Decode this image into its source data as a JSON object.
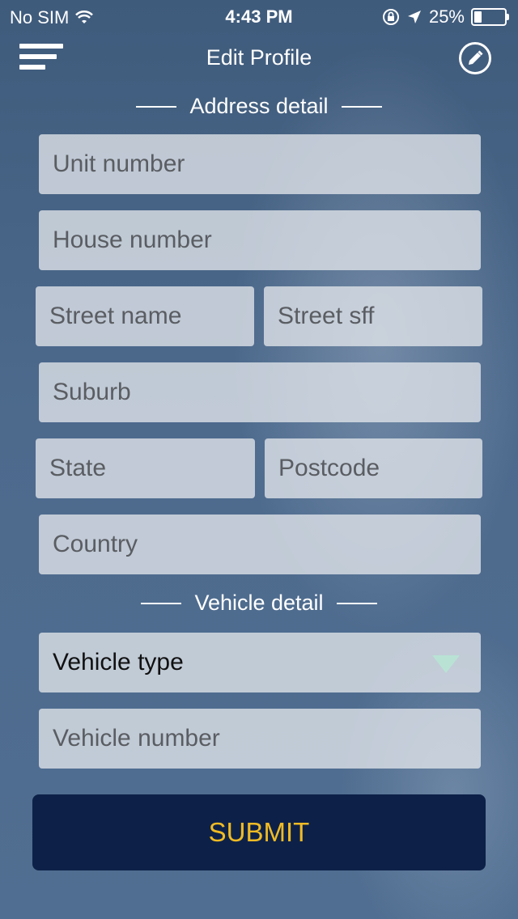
{
  "status_bar": {
    "carrier": "No SIM",
    "time": "4:43 PM",
    "battery_percent": "25%",
    "battery_level": 0.25
  },
  "header": {
    "title": "Edit Profile",
    "menu_icon": "hamburger-menu-icon",
    "edit_icon": "pencil-edit-icon"
  },
  "address_section": {
    "title": "Address detail",
    "fields": {
      "unit_number": "Unit number",
      "house_number": "House number",
      "street_name": "Street name",
      "street_suffix": "Street sff",
      "suburb": "Suburb",
      "state": "State",
      "postcode": "Postcode",
      "country": "Country"
    }
  },
  "vehicle_section": {
    "title": "Vehicle detail",
    "vehicle_type": "Vehicle type",
    "vehicle_number": "Vehicle number"
  },
  "submit_label": "SUBMIT",
  "colors": {
    "submit_background": "#0d2148",
    "submit_text": "#f0bb24",
    "dropdown_caret": "#b9e2d4"
  }
}
